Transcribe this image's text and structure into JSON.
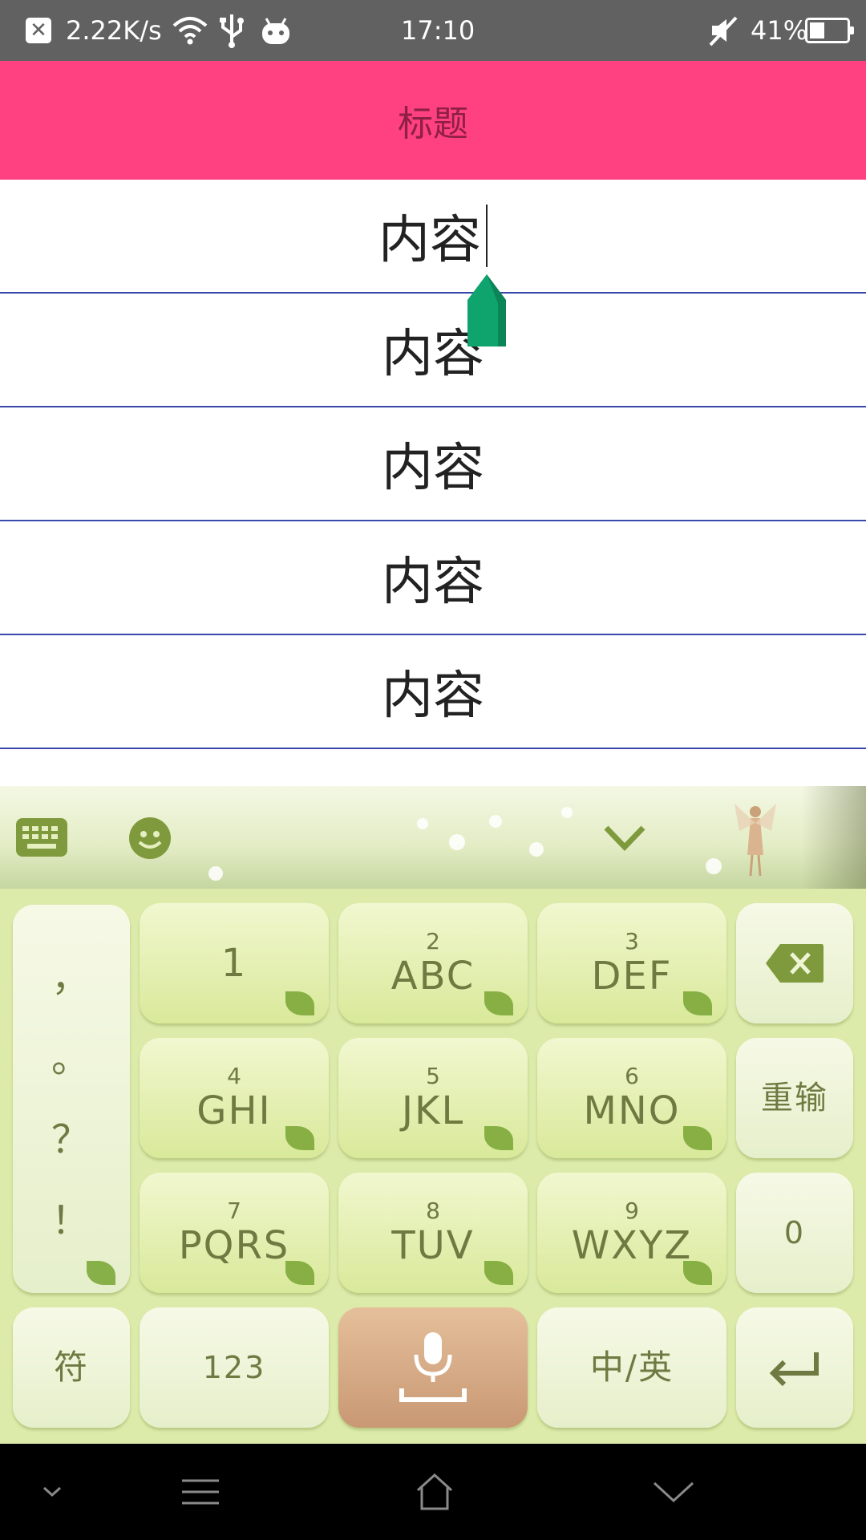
{
  "status_bar": {
    "network_speed": "2.22K/s",
    "time": "17:10",
    "battery_percent": "41%",
    "battery_level": 0.41,
    "icons": [
      "close-notification-icon",
      "wifi-icon",
      "usb-icon",
      "android-icon",
      "mute-icon",
      "battery-icon"
    ]
  },
  "app_bar": {
    "title": "标题",
    "color": "#ff4081"
  },
  "list": {
    "items": [
      "内容",
      "内容",
      "内容",
      "内容",
      "内容"
    ],
    "divider_color": "#3949ab"
  },
  "keyboard": {
    "toolbar_icons": [
      "keyboard-icon",
      "emoji-icon",
      "collapse-keyboard-icon"
    ],
    "punctuation": [
      "，",
      "。",
      "？",
      "！"
    ],
    "keys": [
      {
        "num": "",
        "label": "1"
      },
      {
        "num": "2",
        "label": "ABC"
      },
      {
        "num": "3",
        "label": "DEF"
      },
      {
        "num": "4",
        "label": "GHI"
      },
      {
        "num": "5",
        "label": "JKL"
      },
      {
        "num": "6",
        "label": "MNO"
      },
      {
        "num": "7",
        "label": "PQRS"
      },
      {
        "num": "8",
        "label": "TUV"
      },
      {
        "num": "9",
        "label": "WXYZ"
      }
    ],
    "reinput": "重输",
    "zero": "0",
    "symbol": "符",
    "num_mode": "123",
    "lang_switch": "中/英"
  },
  "nav_bar": {
    "icons": [
      "chevron-down-small-icon",
      "menu-icon",
      "home-icon",
      "chevron-down-icon"
    ]
  }
}
